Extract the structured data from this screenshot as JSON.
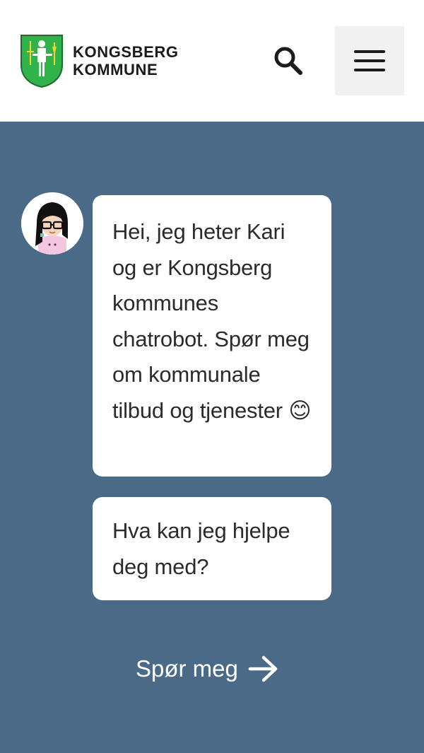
{
  "header": {
    "logo_line1": "KONGSBERG",
    "logo_line2": "KOMMUNE",
    "logo_icon": "coat-of-arms-icon",
    "search_icon": "search-icon",
    "menu_icon": "hamburger-menu-icon"
  },
  "chat": {
    "avatar_icon": "chatbot-avatar-icon",
    "message1": "Hei, jeg heter Kari og er Kongsberg kommunes chatrobot. Spør meg om kommunale tilbud og tjenester 😊",
    "message2": "Hva kan jeg hjelpe deg med?",
    "cta_label": "Spør meg",
    "cta_icon": "arrow-right-icon"
  },
  "colors": {
    "header_bg": "#ffffff",
    "main_bg": "#4a6a88",
    "bubble_bg": "#ffffff",
    "menu_button_bg": "#f1f1f1",
    "crest_green": "#2fb34a"
  }
}
